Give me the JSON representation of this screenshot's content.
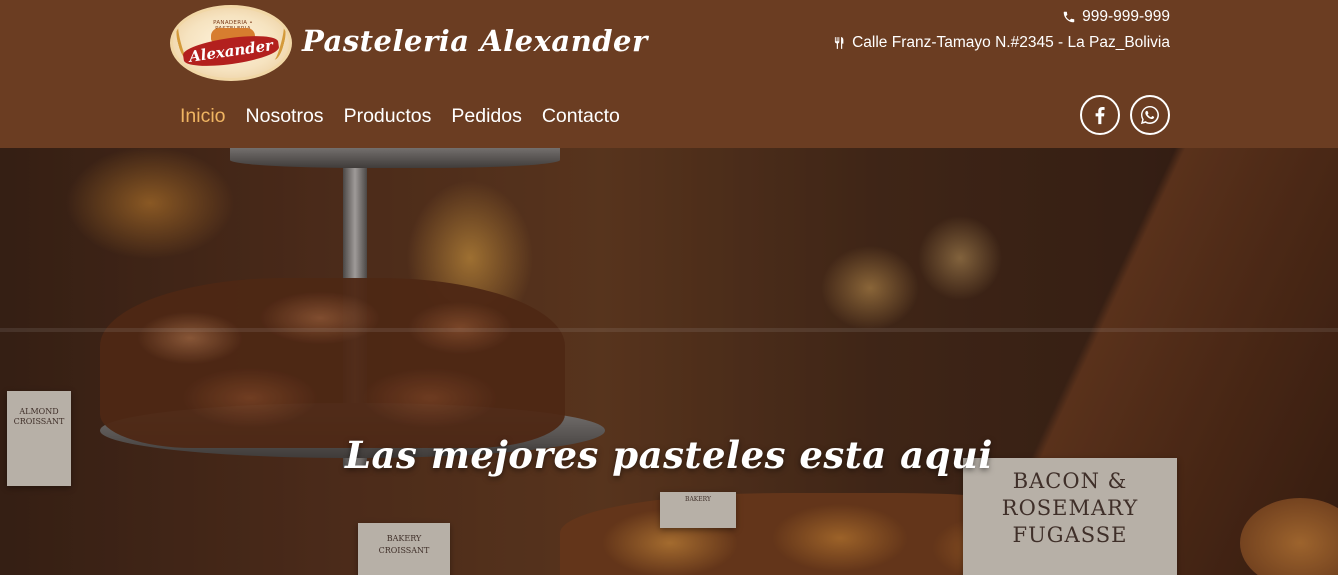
{
  "header": {
    "logo": {
      "top_text": "PANADERIA • PASTELERIA",
      "name": "Alexander"
    },
    "brand_title": "Pasteleria Alexander",
    "phone": "999-999-999",
    "address": "Calle Franz-Tamayo N.#2345 - La Paz_Bolivia",
    "phone_icon": "phone-icon",
    "address_icon": "utensils-icon"
  },
  "nav": {
    "items": [
      {
        "label": "Inicio",
        "active": true
      },
      {
        "label": "Nosotros",
        "active": false
      },
      {
        "label": "Productos",
        "active": false
      },
      {
        "label": "Pedidos",
        "active": false
      },
      {
        "label": "Contacto",
        "active": false
      }
    ],
    "active_color": "#f0b562"
  },
  "social": {
    "facebook_icon": "facebook-icon",
    "whatsapp_icon": "whatsapp-icon"
  },
  "hero": {
    "tagline": "Las mejores pasteles esta aqui",
    "signs": {
      "bacon": [
        "BACON &",
        "ROSEMARY",
        "FUGASSE"
      ],
      "almond": [
        "ALMOND",
        "CROISSANT"
      ],
      "croissant": [
        "BAKERY",
        "CROISSANT"
      ],
      "small": "BAKERY"
    }
  },
  "colors": {
    "header_bg": "#6b3d22",
    "text": "#ffffff"
  }
}
